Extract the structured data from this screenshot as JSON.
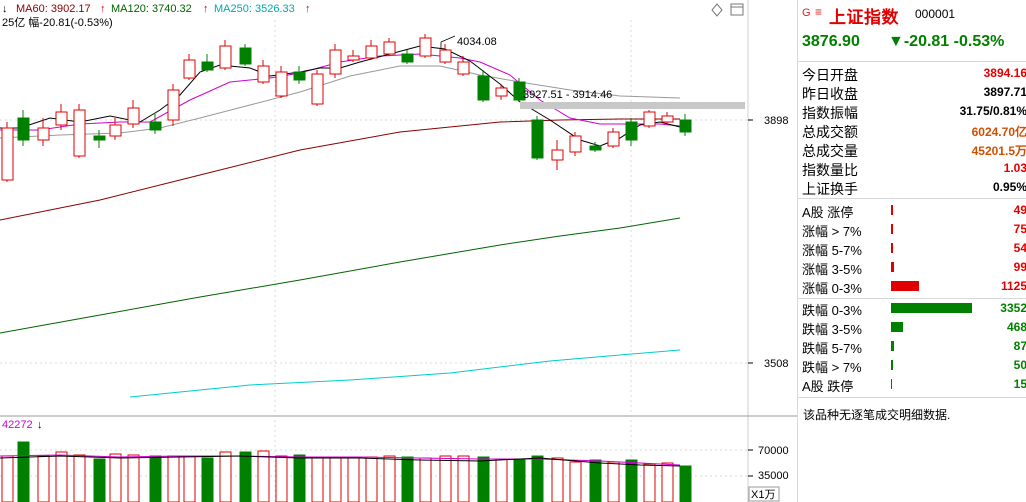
{
  "legend": {
    "arrow": "↓",
    "ma60": "MA60: 3902.17",
    "ma60_arrow": "↑",
    "ma120": "MA120: 3740.32",
    "ma120_arrow": "↑",
    "ma250": "MA250: 3526.33",
    "ma250_arrow": "↑",
    "line2": "25亿 幅-20.81(-0.53%)"
  },
  "annotations": {
    "high": "4034.08",
    "range": "3927.51 - 3914.46"
  },
  "price_axis": {
    "labels": [
      "3898",
      "3508"
    ]
  },
  "volume": {
    "header": "42272",
    "header_arrow": "↓",
    "axis_labels": [
      "70000",
      "35000"
    ],
    "unit": "X1万"
  },
  "colors": {
    "up": "#e00000",
    "down": "#008000",
    "ma5": "#000000",
    "ma10": "#d000d0",
    "ma20": "#999999",
    "ma60": "#8b0000",
    "ma120": "#006400",
    "ma250": "#00cccc"
  },
  "header": {
    "g_icon": "G",
    "menu_icon": "≡",
    "name": "上证指数",
    "code": "000001",
    "price": "3876.90",
    "change": "▼-20.81 -0.53%"
  },
  "stats": [
    {
      "label": "今日开盘",
      "value": "3894.16",
      "color": "#e00000"
    },
    {
      "label": "昨日收盘",
      "value": "3897.71",
      "color": "#000000"
    },
    {
      "label": "指数振幅",
      "value": "31.75/0.81%",
      "color": "#000000"
    },
    {
      "label": "总成交额",
      "value": "6024.70亿",
      "color": "#d05000"
    },
    {
      "label": "总成交量",
      "value": "45201.5万",
      "color": "#d05000"
    },
    {
      "label": "指数量比",
      "value": "1.03",
      "color": "#e00000"
    },
    {
      "label": "上证换手",
      "value": "0.95%",
      "color": "#000000"
    }
  ],
  "distribution": [
    {
      "label": "A股 涨停",
      "value": "49",
      "color": "#e00000",
      "bar": 1.5
    },
    {
      "label": "涨幅 > 7%",
      "value": "75",
      "color": "#e00000",
      "bar": 1.5
    },
    {
      "label": "涨幅 5-7%",
      "value": "54",
      "color": "#e00000",
      "bar": 1.5
    },
    {
      "label": "涨幅 3-5%",
      "value": "99",
      "color": "#e00000",
      "bar": 3
    },
    {
      "label": "涨幅 0-3%",
      "value": "1125",
      "color": "#e00000",
      "bar": 28
    },
    {
      "label": "跌幅 0-3%",
      "value": "3352",
      "color": "#008000",
      "bar": 81
    },
    {
      "label": "跌幅 3-5%",
      "value": "468",
      "color": "#008000",
      "bar": 12
    },
    {
      "label": "跌幅 5-7%",
      "value": "87",
      "color": "#008000",
      "bar": 2.5
    },
    {
      "label": "跌幅 > 7%",
      "value": "50",
      "color": "#008000",
      "bar": 1.5
    },
    {
      "label": "A股 跌停",
      "value": "15",
      "color": "#008000",
      "bar": 1
    }
  ],
  "message": "该品种无逐笔成交明细数据."
}
